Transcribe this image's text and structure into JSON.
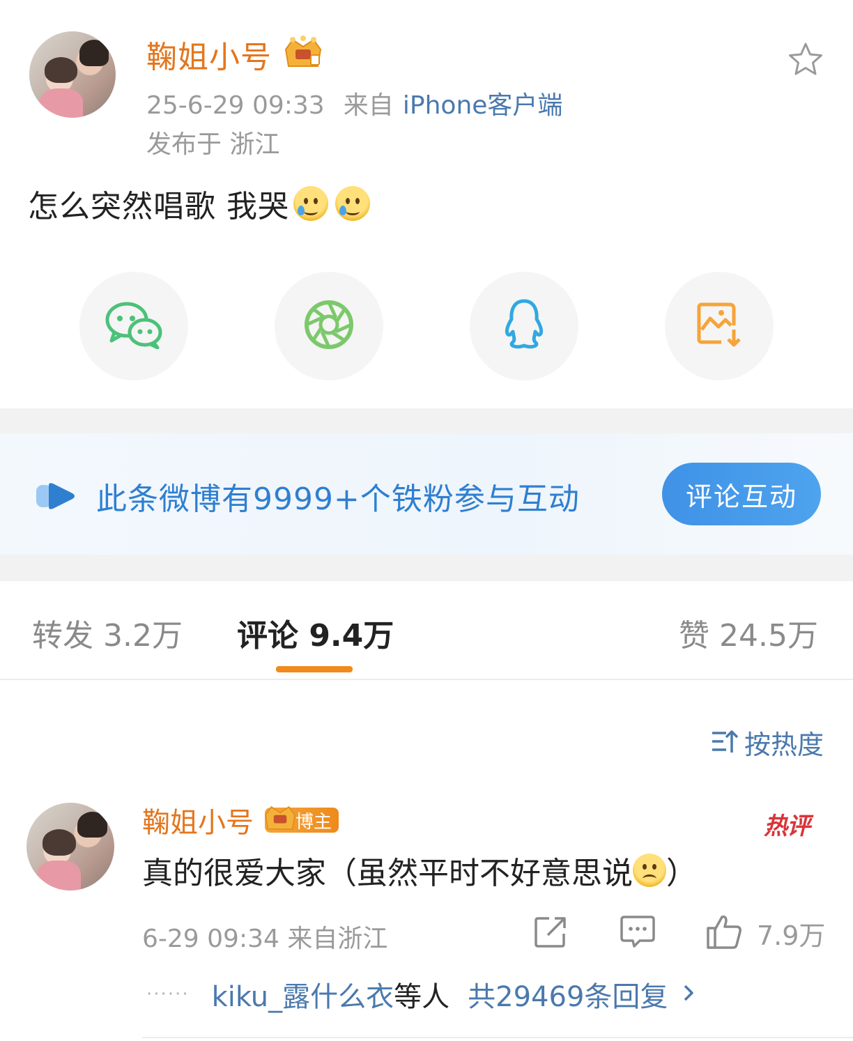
{
  "post": {
    "author": "鞠姐小号",
    "time": "25-6-29 09:33",
    "source_prefix": "来自",
    "source": "iPhone客户端",
    "location": "发布于 浙江",
    "text": "怎么突然唱歌 我哭"
  },
  "share": {
    "items": [
      {
        "icon": "wechat-icon",
        "color": "#4cc17a"
      },
      {
        "icon": "moments-icon",
        "color": "#7bc96a"
      },
      {
        "icon": "qq-icon",
        "color": "#31a8e0"
      },
      {
        "icon": "save-image-icon",
        "color": "#f7a33a"
      }
    ]
  },
  "fans_banner": {
    "text": "此条微博有9999+个铁粉参与互动",
    "button": "评论互动"
  },
  "tabs": {
    "repost": "转发 3.2万",
    "comment": "评论 9.4万",
    "like": "赞 24.5万"
  },
  "sort": {
    "label": "按热度"
  },
  "comment": {
    "author": "鞠姐小号",
    "badge": "博主",
    "hot_tag": "热评",
    "text_before": "真的很爱大家（虽然平时不好意思说",
    "text_after": "）",
    "time": "6-29 09:34 来自浙江",
    "likes": "7.9万",
    "reply_user": "kiku_露什么衣",
    "reply_mid": "等人",
    "reply_count": "共29469条回复",
    "reply_dots": "······"
  },
  "colors": {
    "orange": "#e3761e",
    "link_blue": "#4a79ad",
    "fans_blue": "#2f7fd0",
    "tab_underline": "#f08a1c"
  }
}
